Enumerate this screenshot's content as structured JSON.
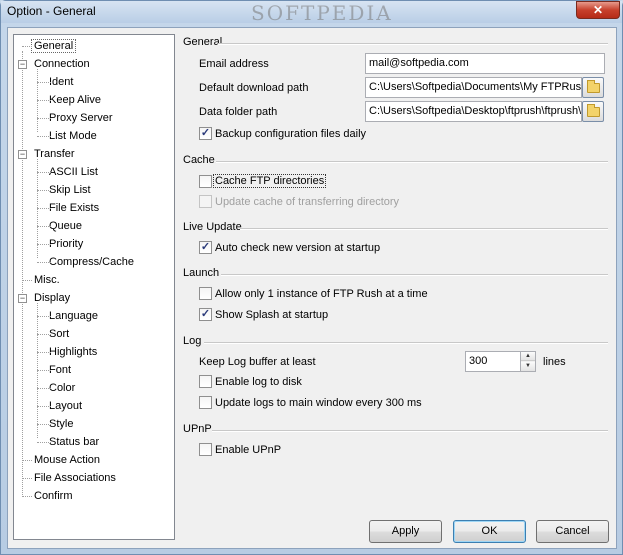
{
  "window": {
    "title": "Option - General",
    "watermark": "SOFTPEDIA",
    "close_label": "✕"
  },
  "tree": {
    "items": [
      {
        "label": "General",
        "level": 0,
        "selected": true
      },
      {
        "label": "Connection",
        "level": 0,
        "expander": "−"
      },
      {
        "label": "Ident",
        "level": 1
      },
      {
        "label": "Keep Alive",
        "level": 1
      },
      {
        "label": "Proxy Server",
        "level": 1
      },
      {
        "label": "List Mode",
        "level": 1
      },
      {
        "label": "Transfer",
        "level": 0,
        "expander": "−"
      },
      {
        "label": "ASCII List",
        "level": 1
      },
      {
        "label": "Skip List",
        "level": 1
      },
      {
        "label": "File Exists",
        "level": 1
      },
      {
        "label": "Queue",
        "level": 1
      },
      {
        "label": "Priority",
        "level": 1
      },
      {
        "label": "Compress/Cache",
        "level": 1
      },
      {
        "label": "Misc.",
        "level": 0
      },
      {
        "label": "Display",
        "level": 0,
        "expander": "−"
      },
      {
        "label": "Language",
        "level": 1
      },
      {
        "label": "Sort",
        "level": 1
      },
      {
        "label": "Highlights",
        "level": 1
      },
      {
        "label": "Font",
        "level": 1
      },
      {
        "label": "Color",
        "level": 1
      },
      {
        "label": "Layout",
        "level": 1
      },
      {
        "label": "Style",
        "level": 1
      },
      {
        "label": "Status bar",
        "level": 1
      },
      {
        "label": "Mouse Action",
        "level": 0
      },
      {
        "label": "File Associations",
        "level": 0
      },
      {
        "label": "Confirm",
        "level": 0
      }
    ]
  },
  "general": {
    "section_title": "General",
    "email_label": "Email address",
    "email_value": "mail@softpedia.com",
    "download_label": "Default download path",
    "download_value": "C:\\Users\\Softpedia\\Documents\\My FTPRush",
    "data_label": "Data folder path",
    "data_value": "C:\\Users\\Softpedia\\Desktop\\ftprush\\ftprush\\",
    "backup_label": "Backup configuration files daily",
    "backup_checked": true
  },
  "cache": {
    "section_title": "Cache",
    "cache_dirs_label": "Cache FTP directories",
    "cache_dirs_checked": false,
    "update_cache_label": "Update cache of transferring directory",
    "update_cache_checked": false
  },
  "live_update": {
    "section_title": "Live Update",
    "auto_check_label": "Auto check new version at startup",
    "auto_check_checked": true
  },
  "launch": {
    "section_title": "Launch",
    "one_instance_label": "Allow only 1 instance of FTP Rush at a time",
    "one_instance_checked": false,
    "splash_label": "Show Splash at startup",
    "splash_checked": true
  },
  "log": {
    "section_title": "Log",
    "buffer_label": "Keep Log buffer at least",
    "buffer_value": "300",
    "buffer_unit": "lines",
    "enable_disk_label": "Enable log to disk",
    "enable_disk_checked": false,
    "update_logs_label": "Update logs to main window every 300 ms",
    "update_logs_checked": false
  },
  "upnp": {
    "section_title": "UPnP",
    "enable_label": "Enable UPnP",
    "enable_checked": false
  },
  "buttons": {
    "apply": "Apply",
    "ok": "OK",
    "cancel": "Cancel"
  },
  "colors": {
    "title_bar": "#c5d7ea",
    "close_button": "#c7402c",
    "default_button_border": "#3c7fb1"
  }
}
